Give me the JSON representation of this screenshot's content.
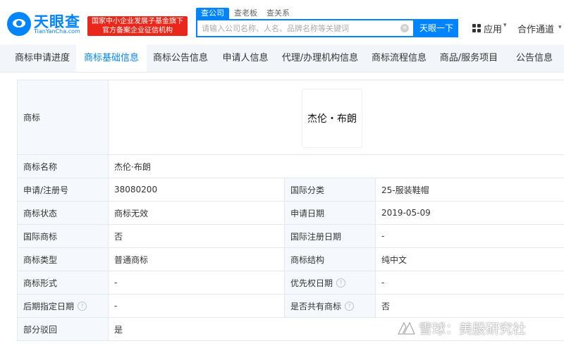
{
  "header": {
    "logo_name": "天眼查",
    "logo_sub": "TianYanCha.com",
    "badge_line1": "国家中小企业发展子基金旗下",
    "badge_line2": "官方备案企业征信机构",
    "search_tabs": [
      "查公司",
      "查老板",
      "查关系"
    ],
    "search_placeholder": "请输入公司名称、人名、品牌名称等关键词",
    "clear_symbol": "×",
    "search_button": "天眼一下",
    "apps_label": "应用",
    "partner_label": "合作通道",
    "caret": "▾"
  },
  "nav": {
    "items": [
      "商标申请进度",
      "商标基础信息",
      "商标公告信息",
      "申请人信息",
      "代理/办理机构信息",
      "商标流程信息",
      "商品/服务项目",
      "公告信息"
    ],
    "active_index": 1
  },
  "trademark": {
    "image_label": "商标",
    "image_text": "杰伦・布朗",
    "name_label": "商标名称",
    "name_value": "杰伦·布朗",
    "rows": [
      {
        "l1": "申请/注册号",
        "v1": "38080200",
        "l2": "国际分类",
        "v2": "25-服装鞋帽",
        "help1": false,
        "help2": false
      },
      {
        "l1": "商标状态",
        "v1": "商标无效",
        "l2": "申请日期",
        "v2": "2019-05-09",
        "help1": false,
        "help2": false
      },
      {
        "l1": "国际商标",
        "v1": "否",
        "l2": "国际注册日期",
        "v2": "-",
        "help1": false,
        "help2": false
      },
      {
        "l1": "商标类型",
        "v1": "普通商标",
        "l2": "商标结构",
        "v2": "纯中文",
        "help1": false,
        "help2": false
      },
      {
        "l1": "商标形式",
        "v1": "-",
        "l2": "优先权日期",
        "v2": "-",
        "help1": false,
        "help2": true
      },
      {
        "l1": "后期指定日期",
        "v1": "-",
        "l2": "是否共有商标",
        "v2": "否",
        "help1": true,
        "help2": true
      }
    ],
    "partial_label": "部分驳回",
    "partial_value": "是",
    "help_symbol": "?"
  },
  "watermark": {
    "text": "雪球：美股研究社"
  },
  "colors": {
    "brand_blue": "#0084ff",
    "badge_red": "#e9271a",
    "label_bg": "#f5f9fd",
    "nav_bg": "#f2f6fb",
    "border": "#e4e9f0"
  }
}
